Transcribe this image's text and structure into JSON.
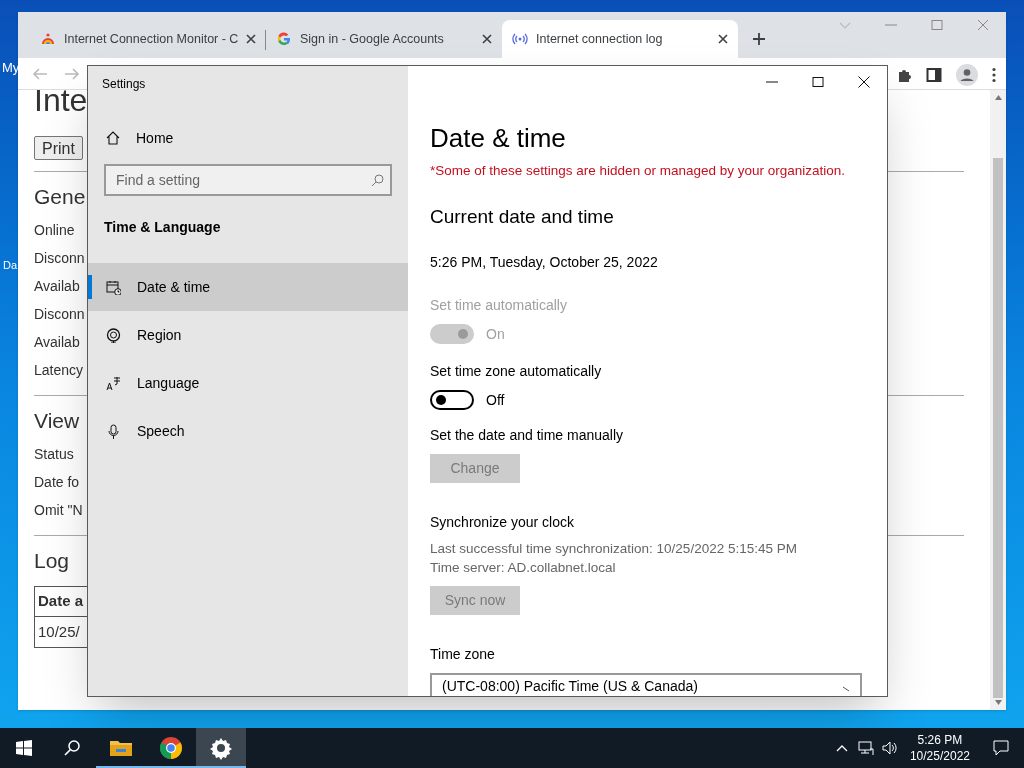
{
  "desktop": {
    "icon_labels": [
      "My",
      "Da"
    ]
  },
  "browser": {
    "tabs": [
      {
        "title": "Internet Connection Monitor - C",
        "selected": false
      },
      {
        "title": "Sign in - Google Accounts",
        "selected": false
      },
      {
        "title": "Internet connection log",
        "selected": true
      }
    ],
    "page": {
      "heading": "Inte",
      "print_button": "Print",
      "sections": [
        {
          "heading": "Gene",
          "lines": [
            "Online",
            "Disconn",
            "Availab",
            "Disconn",
            "Availab",
            "Latency"
          ]
        },
        {
          "heading": "View",
          "lines": [
            "Status",
            "Date fo",
            "Omit \"N"
          ]
        },
        {
          "heading": "Log",
          "table": {
            "header": "Date a",
            "rows": [
              "10/25/"
            ]
          }
        }
      ]
    }
  },
  "settings": {
    "window_title": "Settings",
    "sidebar": {
      "home": "Home",
      "search_placeholder": "Find a setting",
      "category": "Time & Language",
      "items": [
        {
          "label": "Date & time",
          "selected": true
        },
        {
          "label": "Region",
          "selected": false
        },
        {
          "label": "Language",
          "selected": false
        },
        {
          "label": "Speech",
          "selected": false
        }
      ]
    },
    "content": {
      "title": "Date & time",
      "notice": "*Some of these settings are hidden or managed by your organization.",
      "section_title": "Current date and time",
      "current": "5:26 PM, Tuesday, October 25, 2022",
      "blocks": [
        {
          "kind": "toggle",
          "label": "Set time automatically",
          "on": true,
          "disabled": true,
          "state_text": "On"
        },
        {
          "kind": "toggle",
          "label": "Set time zone automatically",
          "on": false,
          "disabled": false,
          "state_text": "Off"
        },
        {
          "kind": "button",
          "label": "Set the date and time manually",
          "button": "Change",
          "disabled": true
        },
        {
          "kind": "sync",
          "label": "Synchronize your clock",
          "lines": [
            "Last successful time synchronization: 10/25/2022 5:15:45 PM",
            "Time server: AD.collabnet.local"
          ],
          "button": "Sync now",
          "disabled": true
        },
        {
          "kind": "select",
          "label": "Time zone",
          "value": "(UTC-08:00) Pacific Time (US & Canada)"
        }
      ]
    }
  },
  "taskbar": {
    "apps": [
      {
        "active": false
      },
      {
        "active": false
      },
      {
        "active": true
      }
    ],
    "time": "5:26 PM",
    "date": "10/25/2022"
  }
}
